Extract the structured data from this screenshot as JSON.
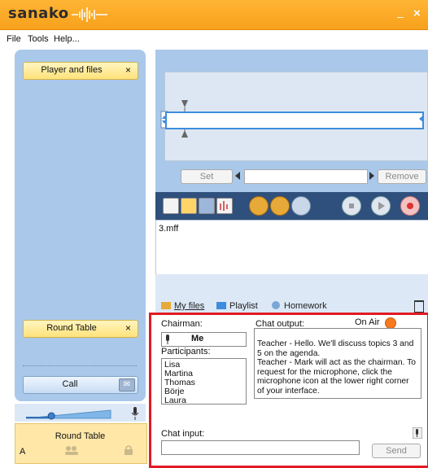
{
  "app": {
    "logo_text": "sanako",
    "brand_color": "#f7a11c",
    "close_glyph": "×",
    "minimize_glyph": "–"
  },
  "menu": {
    "items": [
      "File",
      "Tools",
      "Help..."
    ]
  },
  "left_panel": {
    "player_button": "Player and files",
    "close_glyph": "×",
    "round_table_button": "Round Table",
    "call_button": "Call",
    "bottom_label": "Round Table",
    "bottom_letter": "A",
    "volume_level": 0.3
  },
  "player": {
    "set_button": "Set",
    "remove_button": "Remove",
    "file_name": "3.mff"
  },
  "tabs": {
    "my_files": "My files",
    "playlist": "Playlist",
    "homework": "Homework"
  },
  "chat": {
    "chairman_label": "Chairman:",
    "chairman_value": "Me",
    "participants_label": "Participants:",
    "participants": [
      "Lisa",
      "Martina",
      "Thomas",
      "Börje",
      "Laura"
    ],
    "output_label": "Chat output:",
    "on_air_label": "On Air",
    "on_air_color": "#f7791e",
    "output_text": "Teacher - Hello. We'll discuss topics 3 and 5 on the agenda.\nTeacher - Mark will act as the chairman. To request for the microphone, click the microphone icon at the lower right corner of your interface.",
    "input_label": "Chat input:",
    "input_value": "",
    "send_button": "Send",
    "highlight_color": "#e01b24"
  }
}
